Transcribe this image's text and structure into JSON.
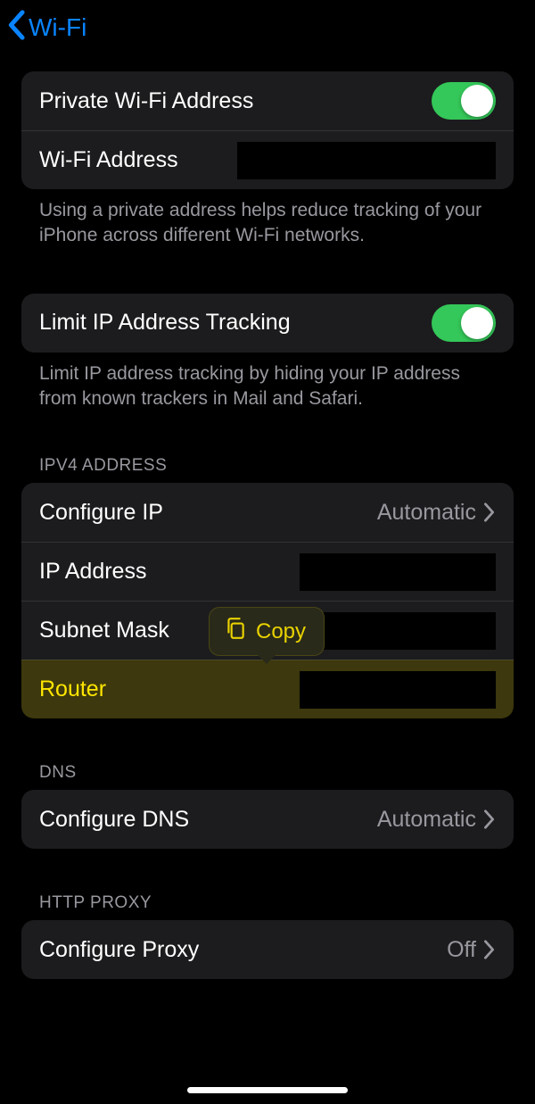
{
  "nav": {
    "back_label": "Wi-Fi"
  },
  "group1": {
    "private_wifi": {
      "label": "Private Wi-Fi Address",
      "on": true
    },
    "wifi_address": {
      "label": "Wi-Fi Address"
    },
    "note": "Using a private address helps reduce tracking of your iPhone across different Wi-Fi networks."
  },
  "group2": {
    "limit_ip": {
      "label": "Limit IP Address Tracking",
      "on": true
    },
    "note": "Limit IP address tracking by hiding your IP address from known trackers in Mail and Safari."
  },
  "ipv4": {
    "header": "IPV4 ADDRESS",
    "configure_ip": {
      "label": "Configure IP",
      "value": "Automatic"
    },
    "ip_address": {
      "label": "IP Address"
    },
    "subnet_mask": {
      "label": "Subnet Mask"
    },
    "router": {
      "label": "Router"
    }
  },
  "dns": {
    "header": "DNS",
    "configure_dns": {
      "label": "Configure DNS",
      "value": "Automatic"
    }
  },
  "proxy": {
    "header": "HTTP PROXY",
    "configure_proxy": {
      "label": "Configure Proxy",
      "value": "Off"
    }
  },
  "popup": {
    "copy_label": "Copy"
  }
}
